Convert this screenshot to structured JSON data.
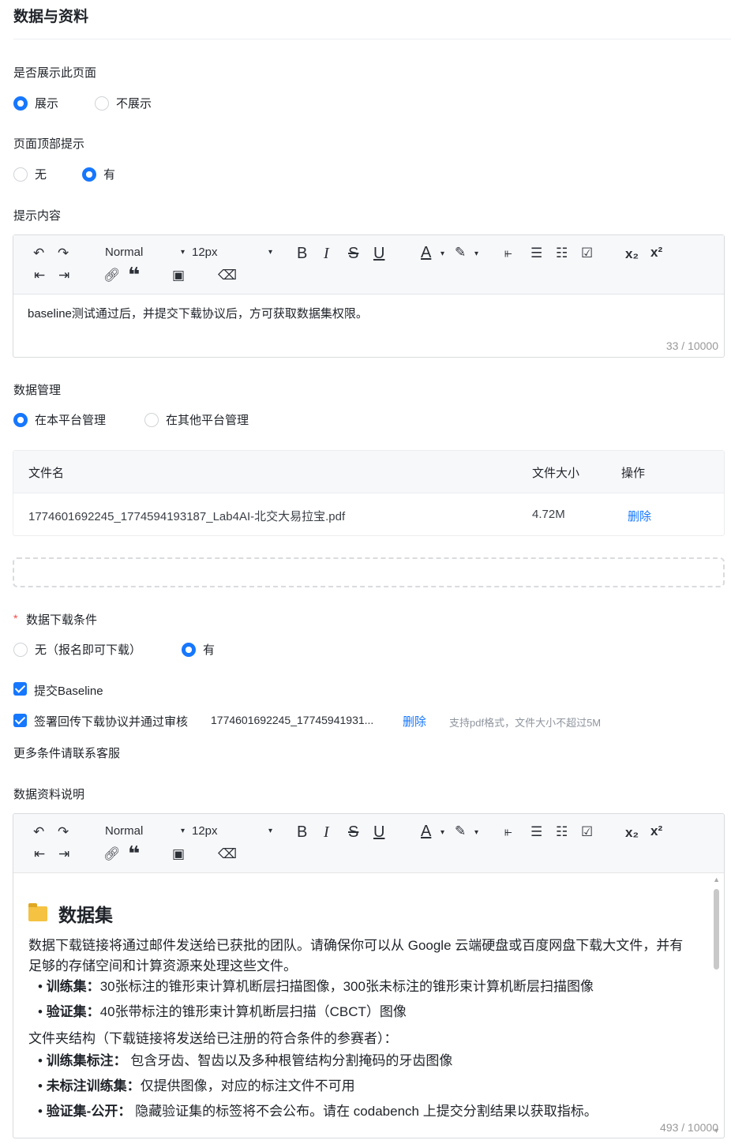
{
  "page_title": "数据与资料",
  "show_page": {
    "label": "是否展示此页面",
    "options": [
      "展示",
      "不展示"
    ],
    "selected": 0
  },
  "top_hint": {
    "label": "页面顶部提示",
    "options": [
      "无",
      "有"
    ],
    "selected": 1
  },
  "hint_content": {
    "label": "提示内容",
    "toolbar": {
      "style": "Normal",
      "size": "12px"
    },
    "text": "baseline测试通过后，并提交下载协议后，方可获取数据集权限。",
    "counter": "33 / 10000"
  },
  "data_mgmt": {
    "label": "数据管理",
    "options": [
      "在本平台管理",
      "在其他平台管理"
    ],
    "selected": 0,
    "table": {
      "headers": [
        "文件名",
        "文件大小",
        "操作"
      ],
      "rows": [
        {
          "name": "1774601692245_1774594193187_Lab4AI-北交大易拉宝.pdf",
          "size": "4.72M",
          "action": "删除"
        }
      ]
    }
  },
  "download_cond": {
    "required_mark": "*",
    "label": "数据下载条件",
    "options": [
      "无（报名即可下载）",
      "有"
    ],
    "selected": 1,
    "check1": "提交Baseline",
    "check2": "签署回传下载协议并通过审核",
    "check2_file": "1774601692245_17745941931...",
    "check2_delete": "删除",
    "check2_hint": "支持pdf格式，文件大小不超过5M",
    "more": "更多条件请联系客服"
  },
  "data_desc": {
    "label": "数据资料说明",
    "toolbar": {
      "style": "Normal",
      "size": "12px"
    },
    "heading_icon": "📁",
    "heading": "数据集",
    "para1": "数据下载链接将通过邮件发送给已获批的团队。请确保你可以从 Google 云端硬盘或百度网盘下载大文件，并有足够的存储空间和计算资源来处理这些文件。",
    "bullets1": [
      {
        "bold": "训练集：",
        "text": "30张标注的锥形束计算机断层扫描图像，300张未标注的锥形束计算机断层扫描图像"
      },
      {
        "bold": "验证集：",
        "text": "40张带标注的锥形束计算机断层扫描（CBCT）图像"
      }
    ],
    "para2": "文件夹结构（下载链接将发送给已注册的符合条件的参赛者）：",
    "bullets2": [
      {
        "bold": "训练集标注：",
        "text": " 包含牙齿、智齿以及多种根管结构分割掩码的牙齿图像"
      },
      {
        "bold": "未标注训练集：",
        "text": "仅提供图像，对应的标注文件不可用"
      },
      {
        "bold": "验证集-公开：",
        "text": " 隐藏验证集的标签将不会公布。请在 codabench 上提交分割结果以获取指标。"
      }
    ],
    "counter": "493 / 10000"
  }
}
